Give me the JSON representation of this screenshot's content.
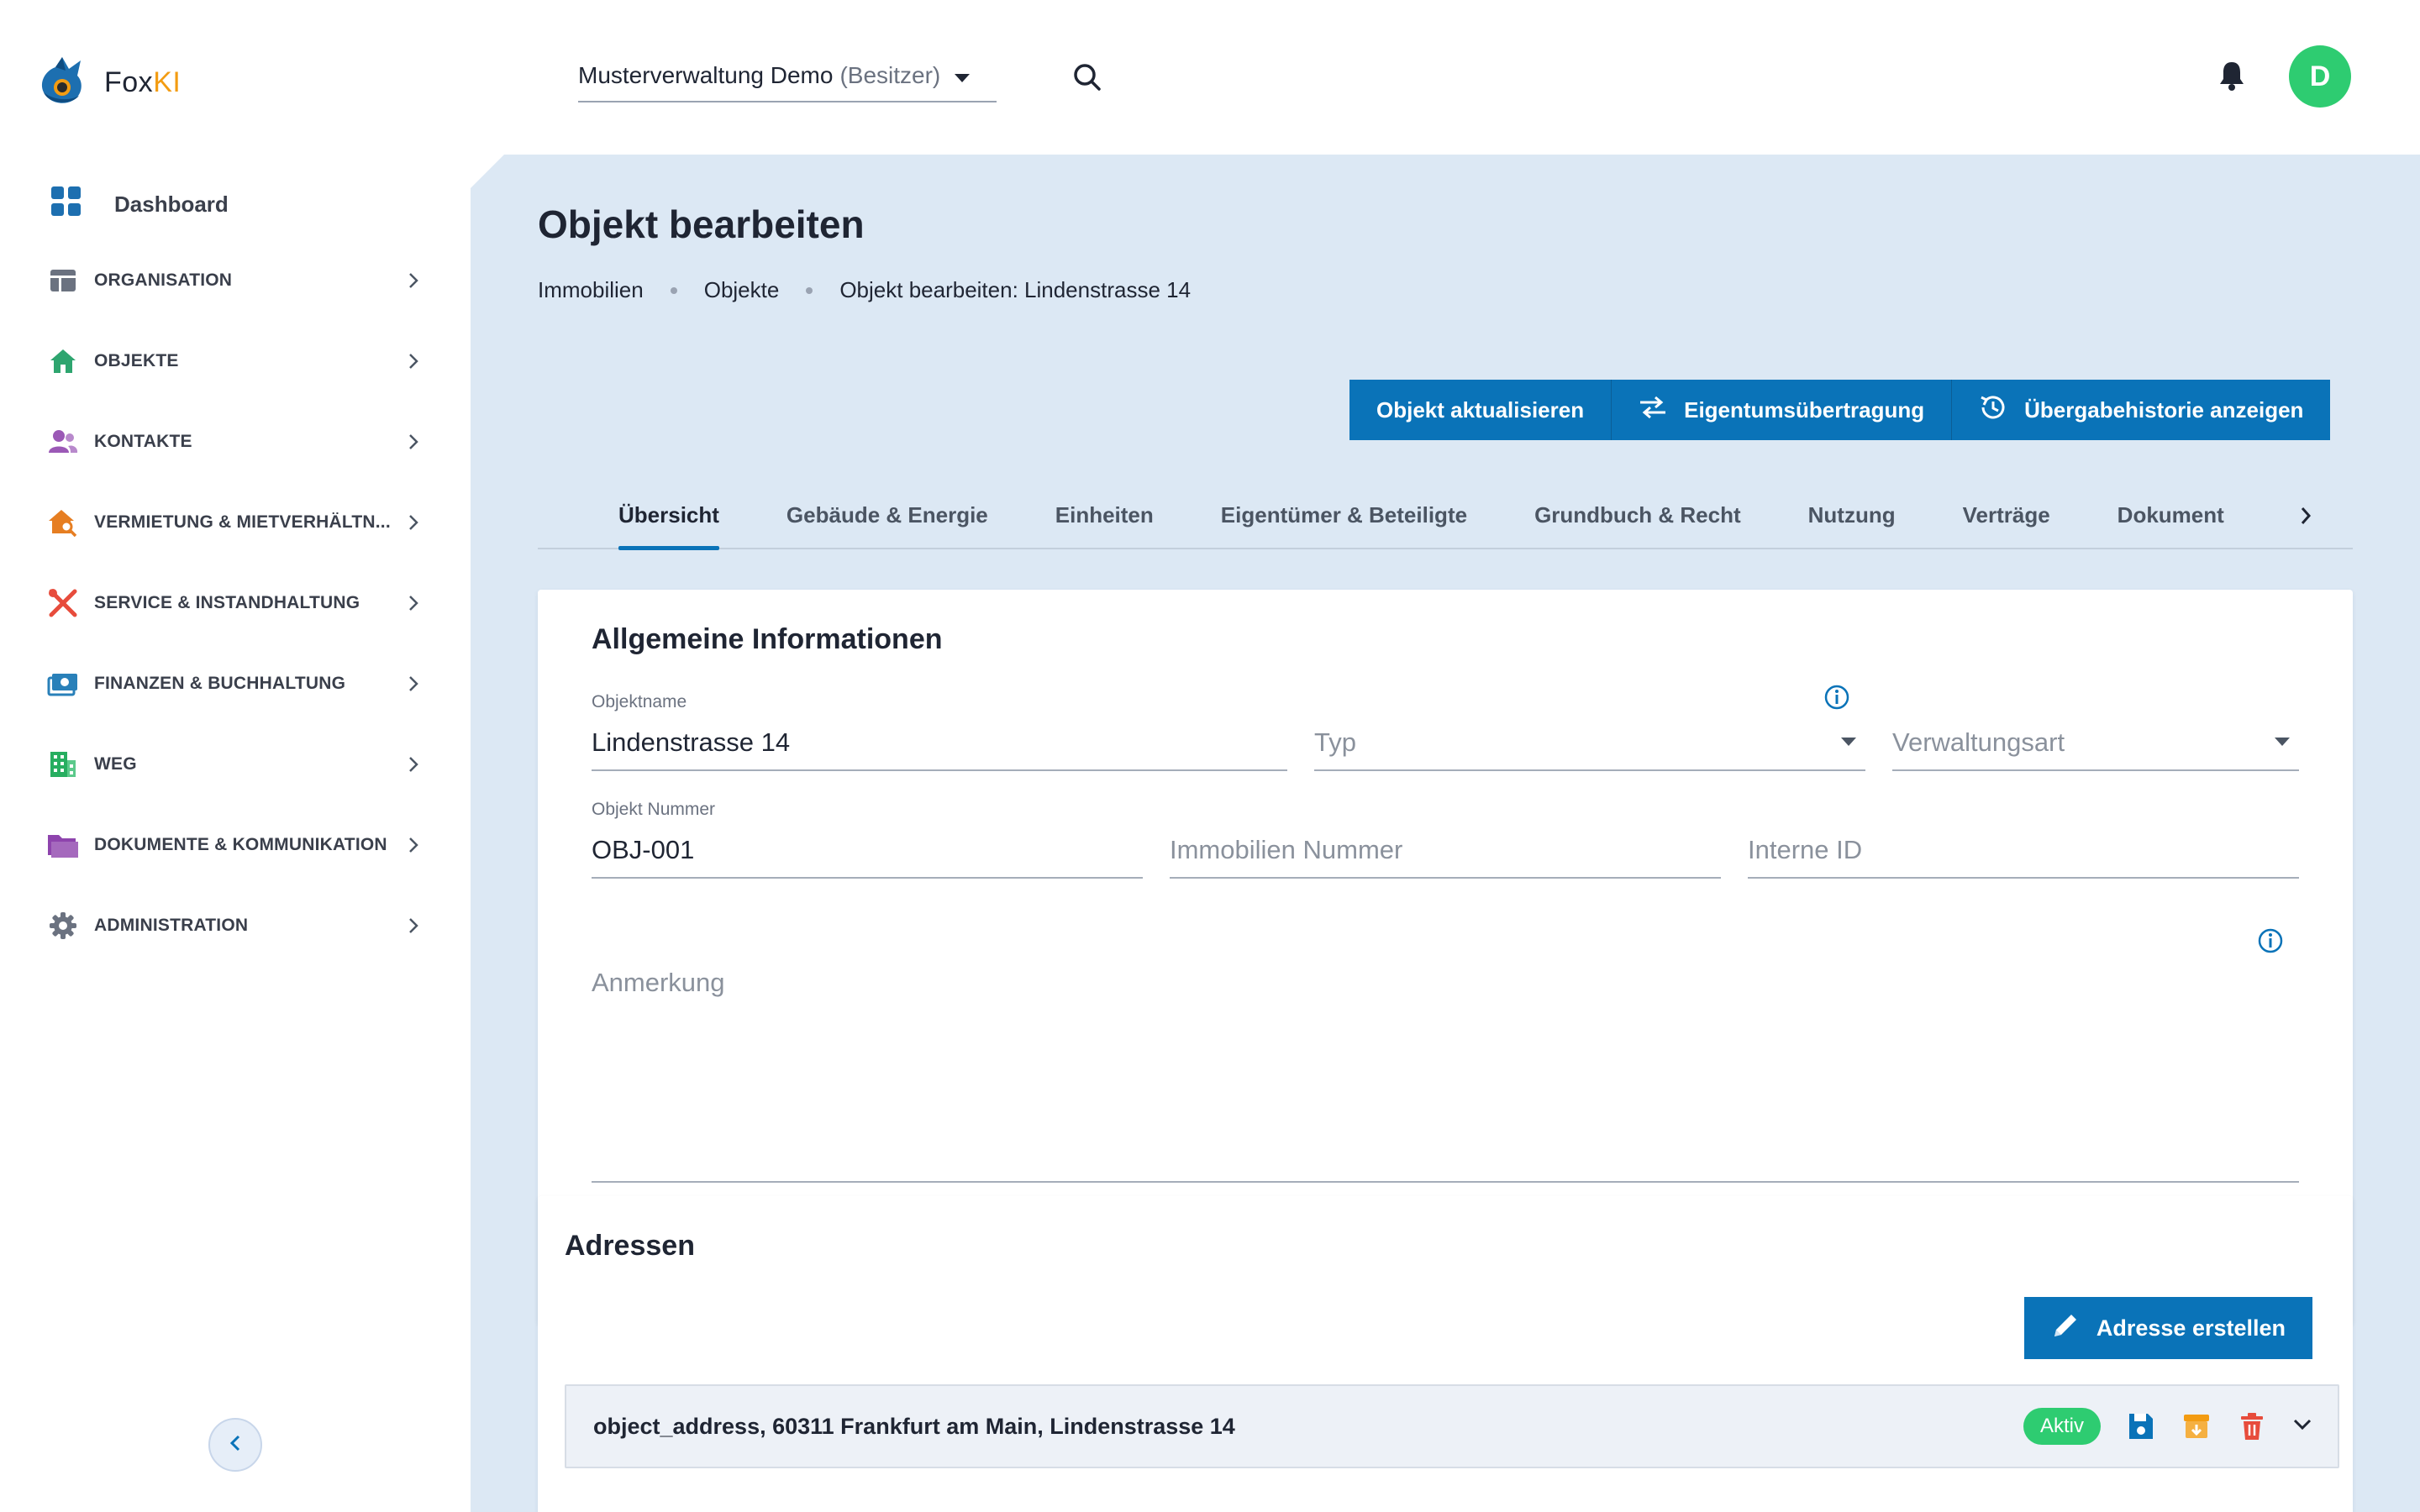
{
  "app": {
    "name_prefix": "Fox",
    "name_suffix": "KI",
    "accent_color": "#0a73b8",
    "highlight_color": "#f39c12"
  },
  "sidebar": {
    "dashboard": {
      "label": "Dashboard",
      "icon": "dashboard-grid-icon"
    },
    "items": [
      {
        "label": "ORGANISATION",
        "icon": "organisation-icon",
        "color": "#6b7280"
      },
      {
        "label": "OBJEKTE",
        "icon": "house-icon",
        "color": "#2ea56f"
      },
      {
        "label": "KONTAKTE",
        "icon": "people-icon",
        "color": "#9b59b6"
      },
      {
        "label": "VERMIETUNG & MIETVERHÄLTN...",
        "icon": "house-search-icon",
        "color": "#e67e22"
      },
      {
        "label": "SERVICE & INSTANDHALTUNG",
        "icon": "tools-icon",
        "color": "#e74c3c"
      },
      {
        "label": "FINANZEN & BUCHHALTUNG",
        "icon": "money-icon",
        "color": "#2980b9"
      },
      {
        "label": "WEG",
        "icon": "building-icon",
        "color": "#27ae60"
      },
      {
        "label": "DOKUMENTE & KOMMUNIKATION",
        "icon": "folder-icon",
        "color": "#8e44ad"
      },
      {
        "label": "ADMINISTRATION",
        "icon": "gear-icon",
        "color": "#6b7280"
      }
    ]
  },
  "topbar": {
    "org_name": "Musterverwaltung Demo",
    "org_role": "(Besitzer)",
    "avatar_initial": "D"
  },
  "page": {
    "title": "Objekt bearbeiten",
    "breadcrumb": [
      "Immobilien",
      "Objekte",
      "Objekt bearbeiten: Lindenstrasse 14"
    ]
  },
  "actions": {
    "update": "Objekt aktualisieren",
    "transfer": "Eigentumsübertragung",
    "history": "Übergabehistorie anzeigen"
  },
  "tabs": [
    "Übersicht",
    "Gebäude & Energie",
    "Einheiten",
    "Eigentümer & Beteiligte",
    "Grundbuch & Recht",
    "Nutzung",
    "Verträge",
    "Dokument"
  ],
  "general": {
    "title": "Allgemeine Informationen",
    "objektname": {
      "label": "Objektname",
      "value": "Lindenstrasse 14"
    },
    "typ": {
      "placeholder": "Typ"
    },
    "verwaltungsart": {
      "placeholder": "Verwaltungsart"
    },
    "objekt_nummer": {
      "label": "Objekt Nummer",
      "value": "OBJ-001"
    },
    "immobilien_nummer": {
      "placeholder": "Immobilien Nummer"
    },
    "interne_id": {
      "placeholder": "Interne ID"
    },
    "anmerkung": {
      "placeholder": "Anmerkung"
    }
  },
  "addresses": {
    "title": "Adressen",
    "create_button": "Adresse erstellen",
    "rows": [
      {
        "text": "object_address, 60311 Frankfurt am Main, Lindenstrasse 14",
        "status": "Aktiv"
      }
    ]
  }
}
